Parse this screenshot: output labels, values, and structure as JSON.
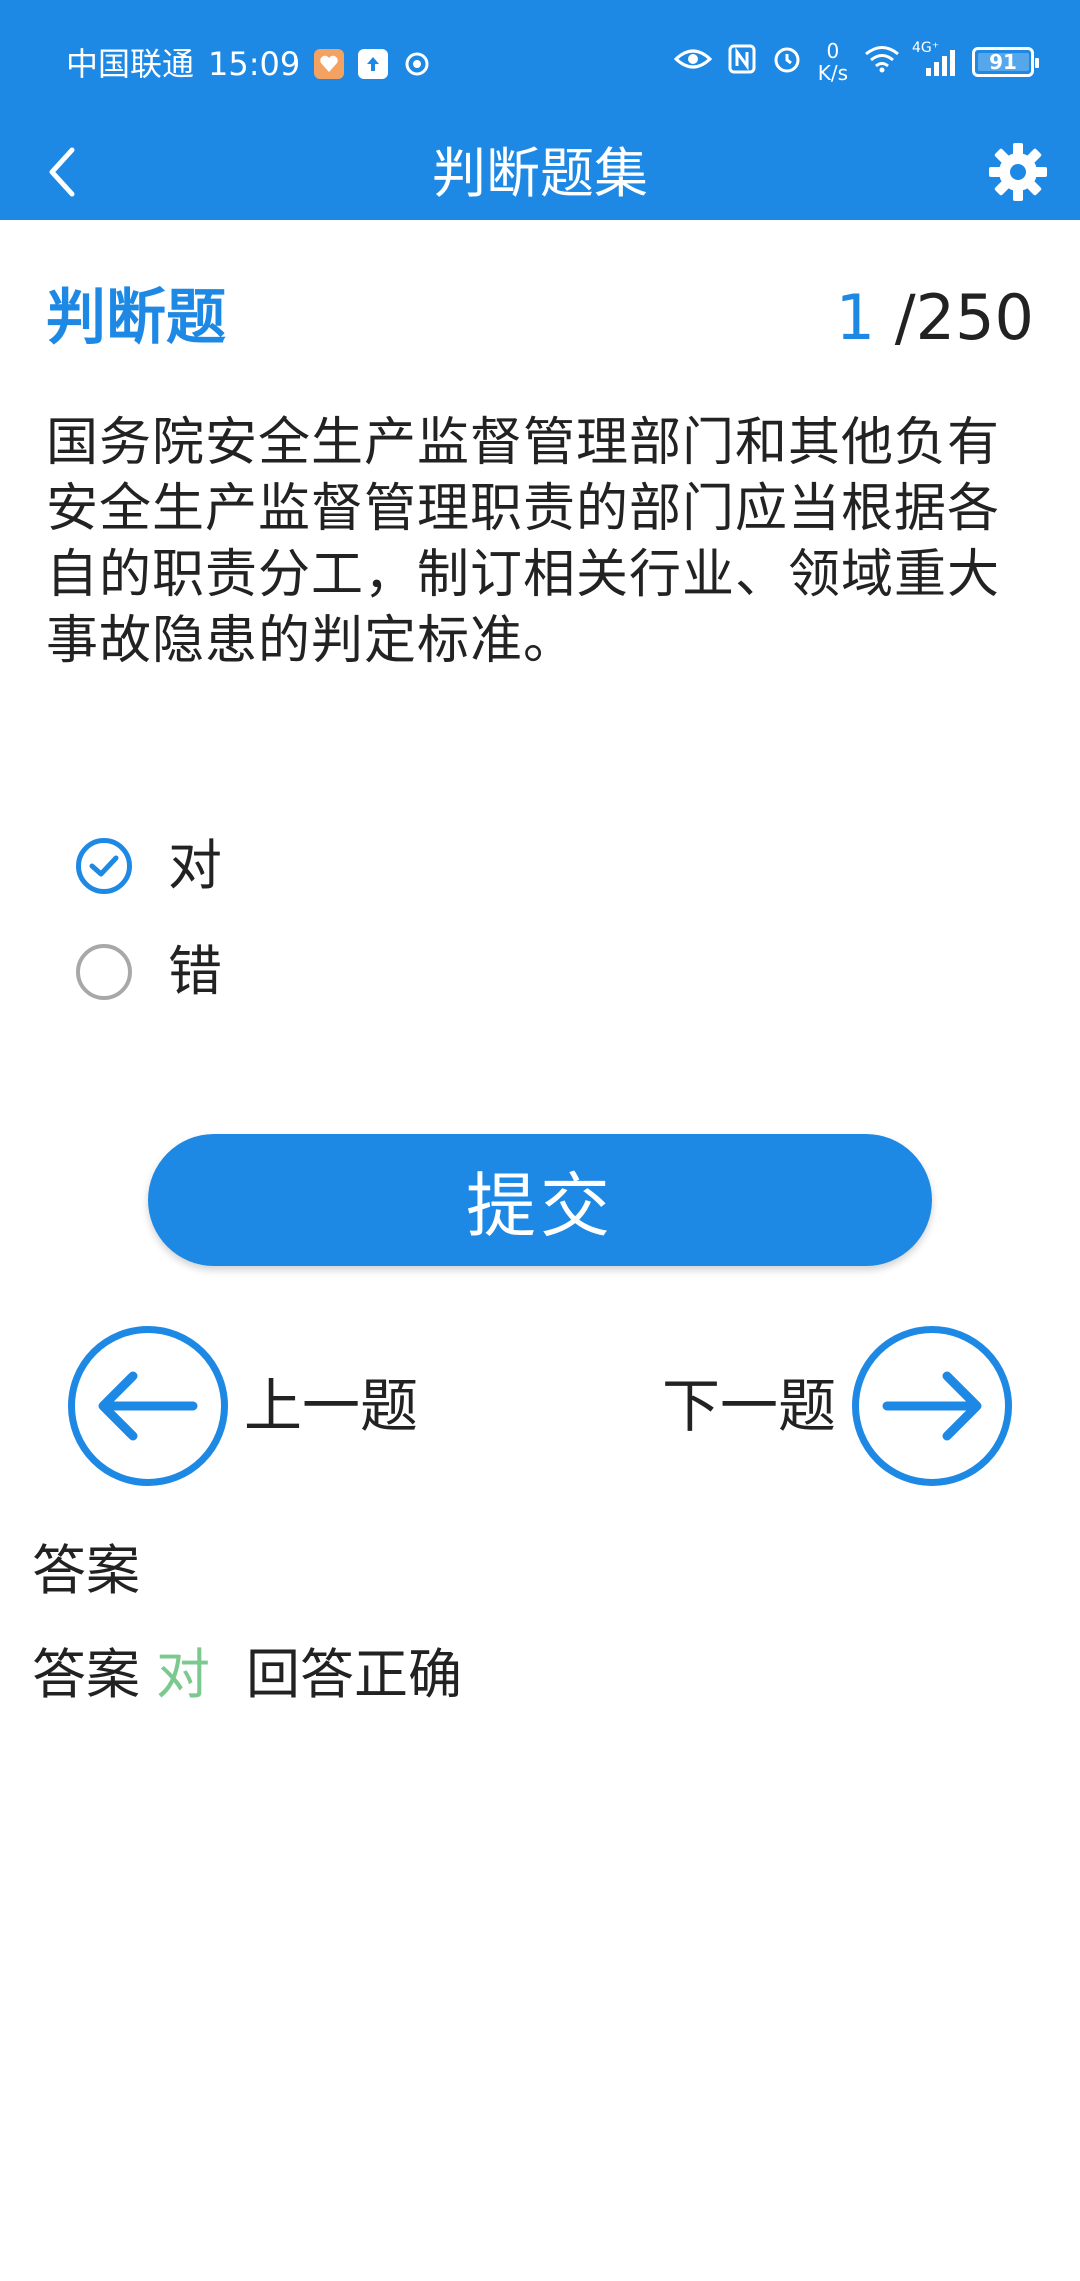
{
  "status_bar": {
    "carrier": "中国联通",
    "time": "15:09",
    "net_speed_value": "0",
    "net_speed_unit": "K/s",
    "signal_label": "4G⁺",
    "battery_level": "91",
    "icons": [
      "weibo-icon",
      "upload-icon",
      "app-icon",
      "eye-icon",
      "nfc-icon",
      "alarm-icon",
      "wifi-icon",
      "signal-icon",
      "battery-icon"
    ]
  },
  "app_bar": {
    "title": "判断题集",
    "back_icon": "chevron-left-icon",
    "settings_icon": "gear-icon"
  },
  "question": {
    "type_label": "判断题",
    "current_index": "1",
    "total_label": "/250",
    "text": "国务院安全生产监督管理部门和其他负有安全生产监督管理职责的部门应当根据各自的职责分工，制订相关行业、领域重大事故隐患的判定标准。"
  },
  "options": [
    {
      "label": "对",
      "selected": true
    },
    {
      "label": "错",
      "selected": false
    }
  ],
  "submit_label": "提交",
  "navigation": {
    "prev_label": "上一题",
    "next_label": "下一题"
  },
  "answer": {
    "title": "答案",
    "prefix": "答案",
    "value": "对",
    "result": "回答正确"
  },
  "colors": {
    "primary": "#1e88e5",
    "correct": "#7cc98f",
    "text": "#222222",
    "radio_unchecked": "#a8a8a8"
  }
}
